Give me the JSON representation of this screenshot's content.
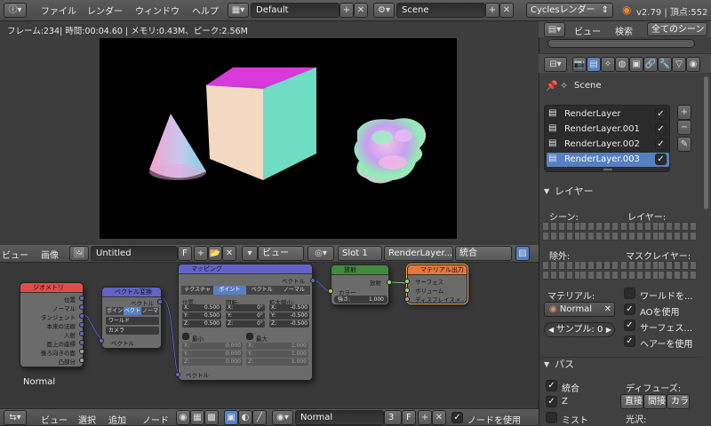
{
  "top_header": {
    "menus": [
      "ファイル",
      "レンダー",
      "ウィンドウ",
      "ヘルプ"
    ],
    "layout_name": "Default",
    "scene_name": "Scene",
    "engine": "Cyclesレンダー",
    "version_info": "v2.79 | 頂点:552"
  },
  "render_info": "フレーム:234| 時間:00:04.60 | メモリ:0.43M、ピーク:2.56M",
  "node_header": {
    "menu_view": "ビュー",
    "menu_image": "画像",
    "image_name": "Untitled",
    "f_label": "F",
    "view_label": "ビュー",
    "slot": "Slot 1",
    "layer": "RenderLayer...",
    "pass": "統合"
  },
  "nodes": {
    "geometry": {
      "title": "ジオメトリ",
      "outputs": [
        "位置",
        "ノーマル",
        "タンジェント",
        "本来の法線",
        "入射",
        "面上の座標",
        "後ろ向きの面",
        "凸部分"
      ]
    },
    "vector_transform": {
      "title": "ベクトル変換",
      "output": "ベクトル",
      "type_options": [
        "ポイン",
        "ベクト",
        "ノーマ"
      ],
      "from": "ワールド",
      "to": "カメラ",
      "input": "ベクトル"
    },
    "mapping": {
      "title": "マッピング",
      "output": "ベクトル",
      "tabs": [
        "テクスチャ",
        "ポイント",
        "ベクトル",
        "ノーマル"
      ],
      "col_labels": [
        "位置:",
        "回転:",
        "拡大縮小:"
      ],
      "loc": [
        "X:",
        "0.500",
        "Y:",
        "0.500",
        "Z:",
        "0.500"
      ],
      "rot": [
        "X:",
        "0°",
        "Y:",
        "0°",
        "Z:",
        "0°"
      ],
      "scale": [
        "X:",
        "-0.500",
        "Y:",
        "-0.500",
        "Z:",
        "-0.500"
      ],
      "min_label": "最小",
      "max_label": "最大",
      "min_vals": [
        "X:",
        "0.000",
        "Y:",
        "0.000",
        "Z:",
        "0.000"
      ],
      "max_vals": [
        "X:",
        "1.000",
        "Y:",
        "1.000",
        "Z:",
        "1.000"
      ],
      "input": "ベクトル"
    },
    "emission": {
      "title": "放射",
      "output": "放射",
      "color_label": "カラー",
      "strength_label": "強さ:",
      "strength_value": "1.000"
    },
    "material_output": {
      "title": "マテリアル出力",
      "inputs": [
        "サーフェス",
        "ボリューム",
        "ディスプレイスメ..."
      ]
    }
  },
  "material_label": "Normal",
  "bottom_header": {
    "menus": [
      "ビュー",
      "選択",
      "追加",
      "ノード"
    ],
    "material_name": "Normal",
    "users": "3",
    "f_label": "F",
    "use_nodes_label": "ノードを使用"
  },
  "properties": {
    "tabs": [
      "ビュー",
      "検索"
    ],
    "filter": "全てのシーン",
    "scene_label": "Scene",
    "render_layers": [
      "RenderLayer",
      "RenderLayer.001",
      "RenderLayer.002",
      "RenderLayer.003"
    ],
    "layer_section": "レイヤー",
    "scene_col": "シーン:",
    "layer_col": "レイヤー:",
    "exclude_col": "除外:",
    "mask_col": "マスクレイヤー:",
    "material_col": "マテリアル:",
    "material_value": "Normal",
    "samples_label": "サンプル:",
    "samples_value": "0",
    "world_label": "ワールドを...",
    "ao_label": "AOを使用",
    "surface_label": "サーフェス...",
    "hair_label": "ヘアーを使用",
    "pass_section": "パス",
    "pass_combined": "統合",
    "pass_z": "Z",
    "pass_mist": "ミスト",
    "diffuse_label": "ディフューズ:",
    "diffuse_buttons": [
      "直接",
      "間接",
      "カラ"
    ],
    "gloss_label": "光沢:"
  },
  "colors": {
    "accent_blue": "#5680c2",
    "node_header_vector": "#6363c7",
    "node_header_input": "#e04c4c",
    "node_header_shader": "#3f8a3f",
    "node_header_output": "#e07a3f"
  }
}
